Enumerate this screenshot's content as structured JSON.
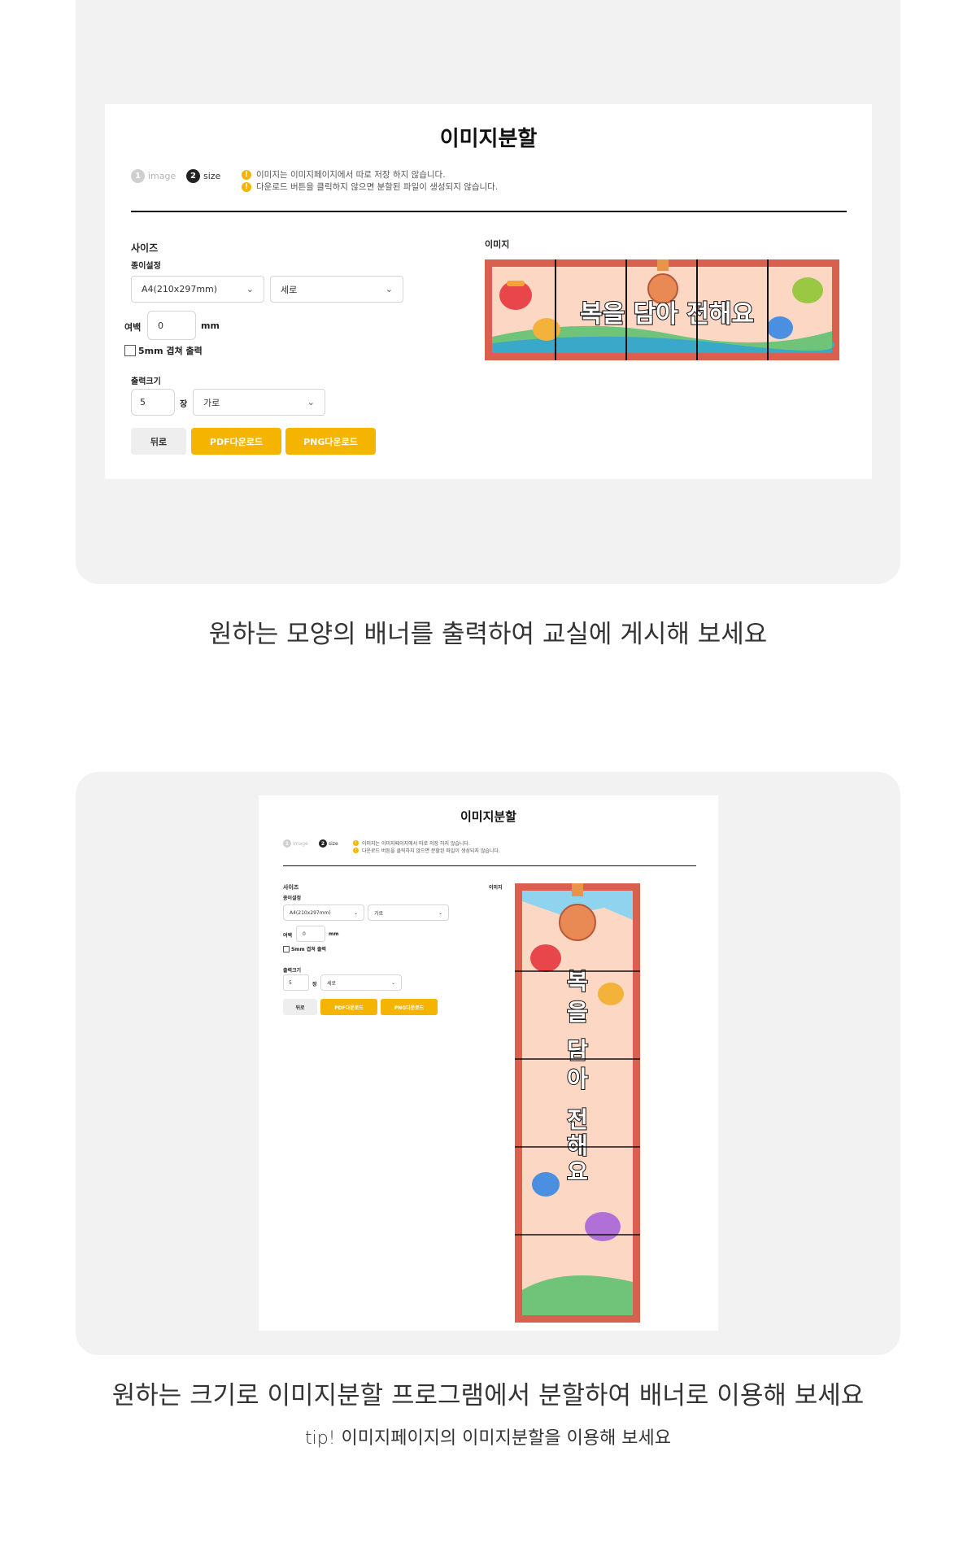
{
  "sections": [
    {
      "caption": "원하는 모양의 배너를 출력하여 교실에 게시해 보세요",
      "mock": {
        "title": "이미지분할",
        "steps": [
          {
            "num": "1",
            "label": "image"
          },
          {
            "num": "2",
            "label": "size"
          }
        ],
        "notices": [
          "이미지는 이미지페이지에서 따로 저장 하지 않습니다.",
          "다운로드 버튼을 클릭하지 않으면 분할된 파일이 생성되지 않습니다."
        ],
        "size_label": "사이즈",
        "paper_label": "종이설정",
        "paper_size": "A4(210x297mm)",
        "orientation": "세로",
        "margin_label": "여백",
        "margin_value": "0",
        "margin_unit": "mm",
        "overlap_label": "5mm 겹쳐 출력",
        "output_label": "출력크기",
        "sheet_count": "5",
        "sheet_unit": "장",
        "direction": "가로",
        "back_label": "뒤로",
        "pdf_label": "PDF다운로드",
        "png_label": "PNG다운로드",
        "image_label": "이미지",
        "banner_text": "복을 담아 전해요",
        "banner_parts": 5
      }
    },
    {
      "caption": "원하는 크기로 이미지분할 프로그램에서 분할하여 배너로 이용해 보세요",
      "tip": "tip! 이미지페이지의 이미지분할을 이용해 보세요",
      "mock": {
        "title": "이미지분할",
        "steps": [
          {
            "num": "1",
            "label": "image"
          },
          {
            "num": "2",
            "label": "size"
          }
        ],
        "notices": [
          "이미지는 이미지페이지에서 따로 저장 하지 않습니다.",
          "다운로드 버튼을 클릭하지 않으면 분할된 파일이 생성되지 않습니다."
        ],
        "size_label": "사이즈",
        "paper_label": "종이설정",
        "paper_size": "A4(210x297mm)",
        "orientation": "가로",
        "margin_label": "여백",
        "margin_value": "0",
        "margin_unit": "mm",
        "overlap_label": "5mm 겹쳐 출력",
        "output_label": "출력크기",
        "sheet_count": "5",
        "sheet_unit": "장",
        "direction": "세로",
        "back_label": "뒤로",
        "pdf_label": "PDF다운로드",
        "png_label": "PNG다운로드",
        "image_label": "이미지",
        "banner_chars": [
          "복",
          "을",
          "담",
          "아",
          "전",
          "해",
          "요"
        ],
        "banner_parts": 5
      }
    }
  ],
  "colors": {
    "accent": "#f5b400",
    "banner_border": "#d9604f",
    "banner_bg": "#fcd8c4",
    "banner_text_fill": "#ffffff",
    "banner_text_stroke": "#111111"
  }
}
